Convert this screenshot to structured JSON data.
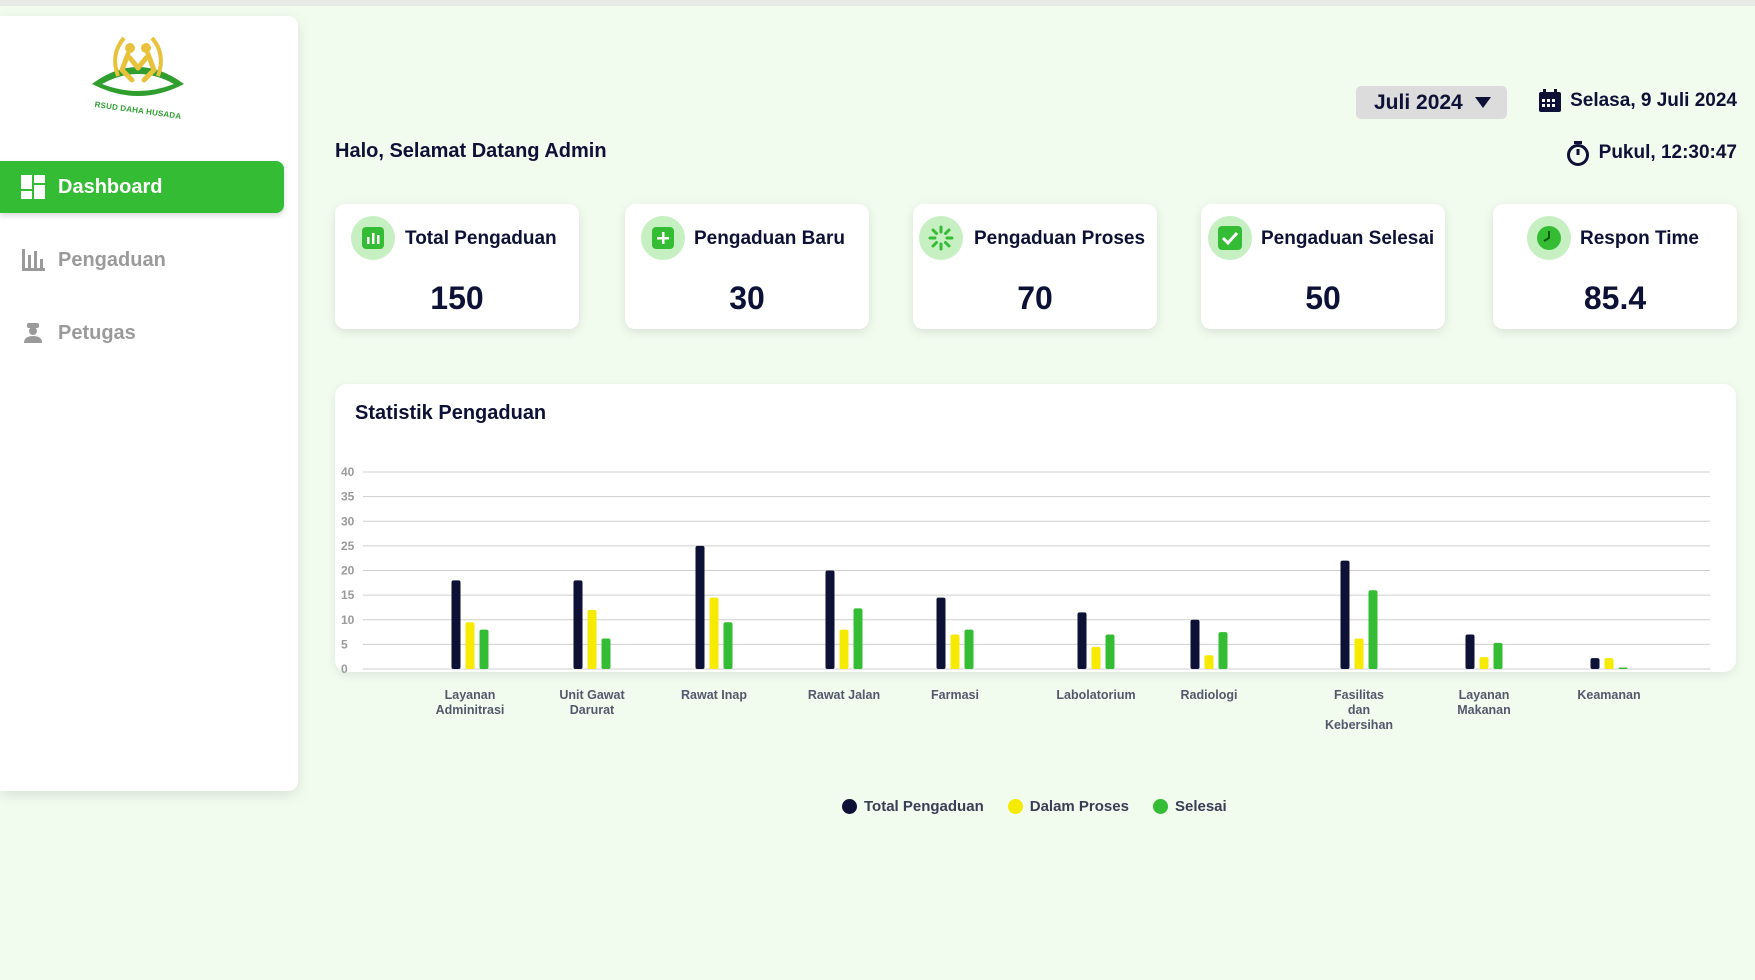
{
  "logo": {
    "text": "RSUD DAHA HUSADA"
  },
  "sidebar": {
    "items": [
      {
        "label": "Dashboard",
        "icon": "dashboard-icon",
        "active": true
      },
      {
        "label": "Pengaduan",
        "icon": "bar-chart-icon",
        "active": false
      },
      {
        "label": "Petugas",
        "icon": "officer-icon",
        "active": false
      }
    ]
  },
  "header": {
    "greeting": "Halo, Selamat Datang Admin",
    "month": "Juli 2024",
    "date": "Selasa, 9 Juli 2024",
    "time": "Pukul, 12:30:47"
  },
  "cards": [
    {
      "title": "Total Pengaduan",
      "value": "150",
      "icon": "stats-icon"
    },
    {
      "title": "Pengaduan Baru",
      "value": "30",
      "icon": "plus-icon"
    },
    {
      "title": "Pengaduan Proses",
      "value": "70",
      "icon": "loading-icon"
    },
    {
      "title": "Pengaduan Selesai",
      "value": "50",
      "icon": "check-icon"
    },
    {
      "title": "Respon Time",
      "value": "85.4",
      "icon": "clock-icon"
    }
  ],
  "colors": {
    "accent": "#34bd34",
    "navy": "#0d1136",
    "yellow": "#f5ea00",
    "green": "#34bd34",
    "background": "#f1fbee"
  },
  "chart_title": "Statistik Pengaduan",
  "chart_data": {
    "type": "bar",
    "categories": [
      [
        "Layanan",
        "Adminitrasi"
      ],
      [
        "Unit Gawat",
        "Darurat"
      ],
      [
        "Rawat Inap"
      ],
      [
        "Rawat  Jalan"
      ],
      [
        "Farmasi"
      ],
      [
        "Labolatorium"
      ],
      [
        "Radiologi"
      ],
      [
        "Fasilitas",
        "dan",
        "Kebersihan"
      ],
      [
        "Layanan",
        "Makanan"
      ],
      [
        "Keamanan"
      ]
    ],
    "series": [
      {
        "name": "Total Pengaduan",
        "color": "#0d1136",
        "values": [
          18,
          18,
          25,
          20,
          14.5,
          11.5,
          10,
          22,
          7,
          2.2
        ]
      },
      {
        "name": "Dalam Proses",
        "color": "#f5ea00",
        "values": [
          9.5,
          12,
          14.5,
          8,
          7,
          4.5,
          2.8,
          6.2,
          2.4,
          2.2
        ]
      },
      {
        "name": "Selesai",
        "color": "#34bd34",
        "values": [
          8,
          6.2,
          9.5,
          12.3,
          8,
          7,
          7.5,
          16,
          5.3,
          0.3
        ]
      }
    ],
    "yticks": [
      0,
      5,
      10,
      15,
      20,
      25,
      30,
      35,
      40
    ],
    "ylim": [
      0,
      40
    ],
    "grid": true,
    "legend": "bottom-center"
  }
}
